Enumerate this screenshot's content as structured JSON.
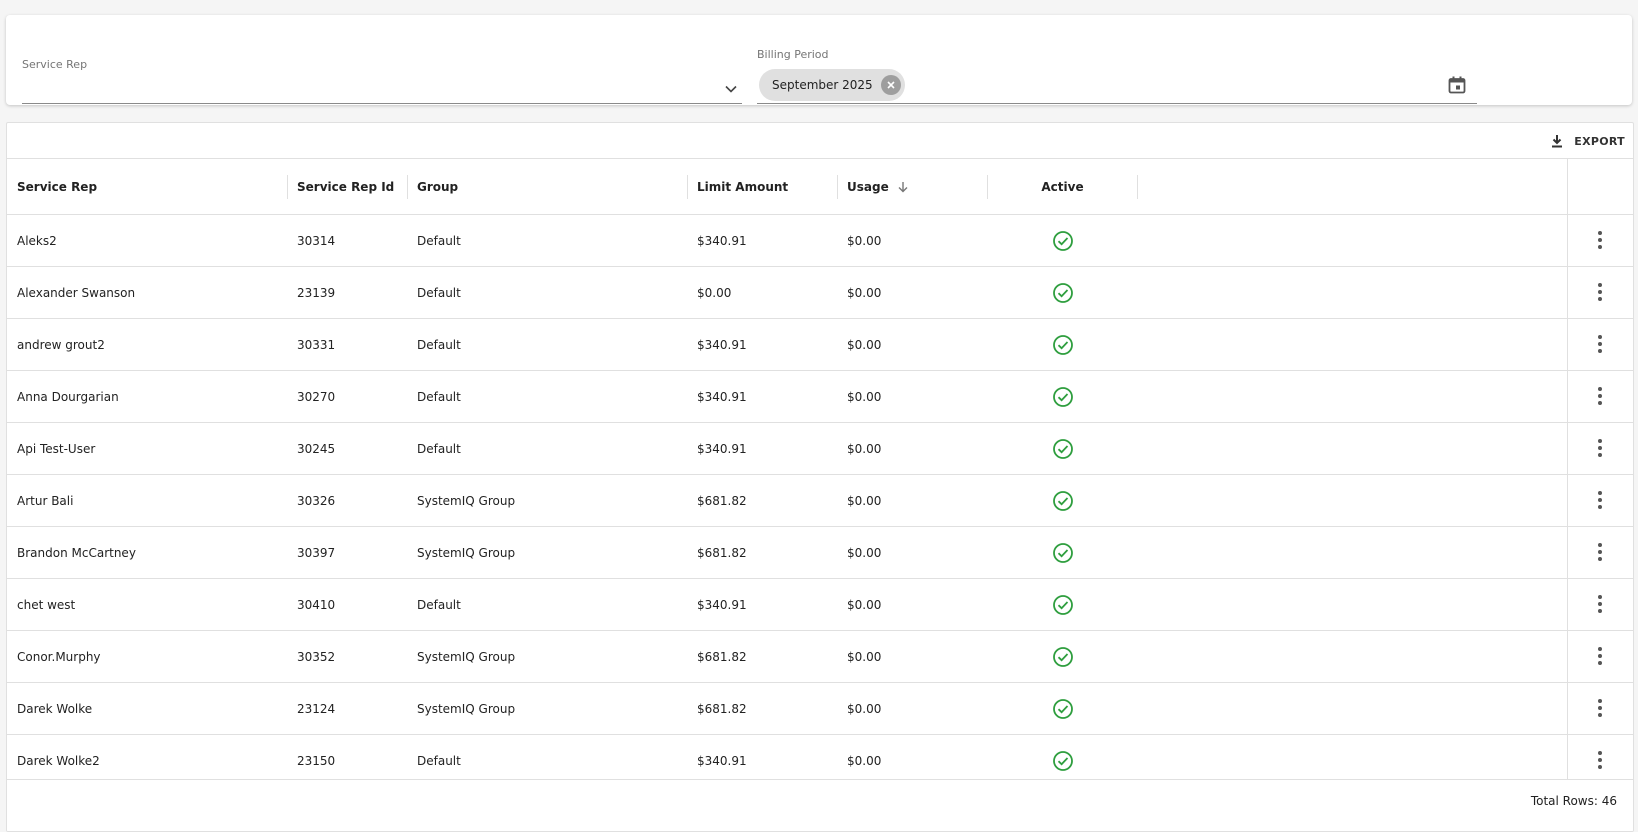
{
  "filters": {
    "service_rep_label": "Service Rep",
    "service_rep_value": "",
    "billing_period_label": "Billing Period",
    "billing_period_chip": "September 2025"
  },
  "toolbar": {
    "export_label": "EXPORT"
  },
  "table": {
    "columns": [
      {
        "label": "Service Rep"
      },
      {
        "label": "Service Rep Id"
      },
      {
        "label": "Group"
      },
      {
        "label": "Limit Amount"
      },
      {
        "label": "Usage",
        "sorted": "desc"
      },
      {
        "label": "Active"
      }
    ],
    "rows": [
      {
        "service_rep": "Aleks2",
        "service_rep_id": "30314",
        "group": "Default",
        "limit_amount": "$340.91",
        "usage": "$0.00",
        "active": true
      },
      {
        "service_rep": "Alexander Swanson",
        "service_rep_id": "23139",
        "group": "Default",
        "limit_amount": "$0.00",
        "usage": "$0.00",
        "active": true
      },
      {
        "service_rep": "andrew grout2",
        "service_rep_id": "30331",
        "group": "Default",
        "limit_amount": "$340.91",
        "usage": "$0.00",
        "active": true
      },
      {
        "service_rep": "Anna Dourgarian",
        "service_rep_id": "30270",
        "group": "Default",
        "limit_amount": "$340.91",
        "usage": "$0.00",
        "active": true
      },
      {
        "service_rep": "Api Test-User",
        "service_rep_id": "30245",
        "group": "Default",
        "limit_amount": "$340.91",
        "usage": "$0.00",
        "active": true
      },
      {
        "service_rep": "Artur Bali",
        "service_rep_id": "30326",
        "group": "SystemIQ Group",
        "limit_amount": "$681.82",
        "usage": "$0.00",
        "active": true
      },
      {
        "service_rep": "Brandon McCartney",
        "service_rep_id": "30397",
        "group": "SystemIQ Group",
        "limit_amount": "$681.82",
        "usage": "$0.00",
        "active": true
      },
      {
        "service_rep": "chet west",
        "service_rep_id": "30410",
        "group": "Default",
        "limit_amount": "$340.91",
        "usage": "$0.00",
        "active": true
      },
      {
        "service_rep": "Conor.Murphy",
        "service_rep_id": "30352",
        "group": "SystemIQ Group",
        "limit_amount": "$681.82",
        "usage": "$0.00",
        "active": true
      },
      {
        "service_rep": "Darek Wolke",
        "service_rep_id": "23124",
        "group": "SystemIQ Group",
        "limit_amount": "$681.82",
        "usage": "$0.00",
        "active": true
      },
      {
        "service_rep": "Darek Wolke2",
        "service_rep_id": "23150",
        "group": "Default",
        "limit_amount": "$340.91",
        "usage": "$0.00",
        "active": true
      }
    ]
  },
  "footer": {
    "total_rows": "Total Rows: 46"
  },
  "colors": {
    "active_check": "#2e9e3e",
    "border": "#e0e0e0",
    "chip_bg": "#e0e0e0"
  },
  "icons": {
    "dropdown": "chevron-down-icon",
    "chip_delete": "cancel-circle-icon",
    "calendar": "calendar-icon",
    "export": "download-icon",
    "sort": "arrow-down-icon",
    "active": "check-circle-icon",
    "row_menu": "more-vert-icon"
  }
}
